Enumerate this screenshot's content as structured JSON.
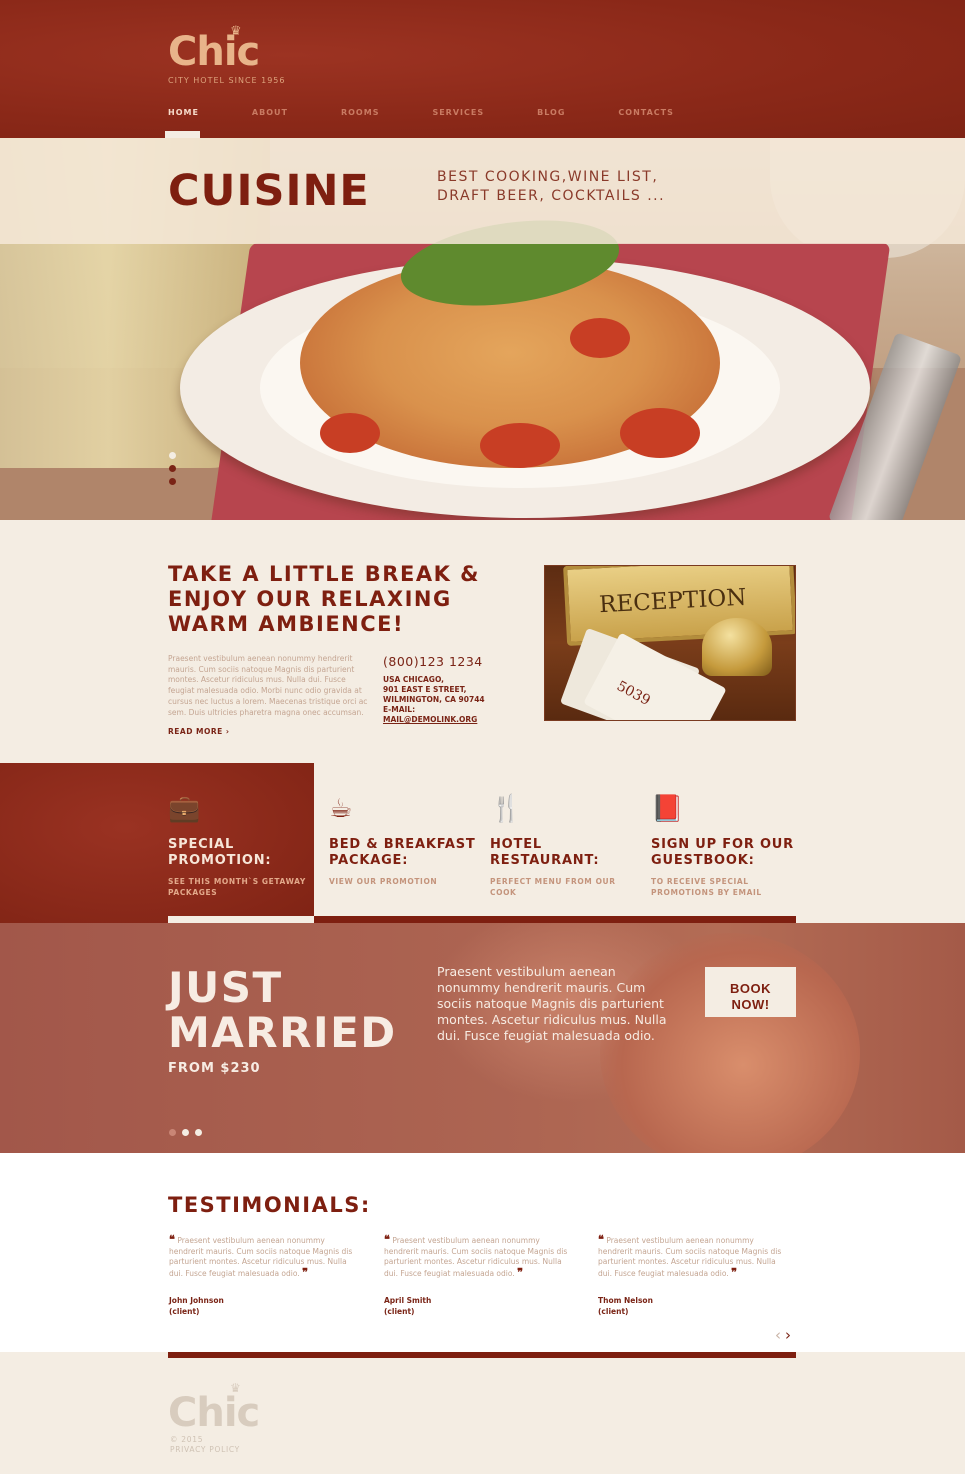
{
  "header": {
    "logo_text": "Chic",
    "tagline": "CITY HOTEL SINCE 1956",
    "nav": [
      {
        "label": "HOME",
        "active": true
      },
      {
        "label": "ABOUT",
        "active": false
      },
      {
        "label": "ROOMS",
        "active": false
      },
      {
        "label": "SERVICES",
        "active": false
      },
      {
        "label": "BLOG",
        "active": false
      },
      {
        "label": "CONTACTS",
        "active": false
      }
    ]
  },
  "hero": {
    "title": "CUISINE",
    "subtitle": "BEST COOKING,WINE LIST, DRAFT BEER, COCKTAILS ...",
    "slides_count": 3,
    "active_slide": 1
  },
  "about": {
    "title": "TAKE A LITTLE BREAK & ENJOY OUR RELAXING WARM AMBIENCE!",
    "text": "Praesent vestibulum aenean nonummy hendrerit mauris. Cum sociis natoque Magnis dis parturient montes. Ascetur ridiculus mus. Nulla dui. Fusce feugiat malesuada odio. Morbi nunc odio gravida at cursus nec luctus a lorem. Maecenas tristique orci ac sem. Duis ultricies pharetra magna onec accumsan.",
    "read_more": "READ MORE",
    "phone": "(800)123 1234",
    "address_line1": "USA  CHICAGO,",
    "address_line2": "901 EAST E STREET,",
    "address_line3": "WILMINGTON, CA 90744",
    "email_label": "E-MAIL:",
    "email": "MAIL@DEMOLINK.ORG",
    "image_sign_text": "RECEPTION",
    "image_card_text": "5039"
  },
  "features": [
    {
      "icon": "suitcase-icon",
      "glyph": "💼",
      "title": "SPECIAL PROMOTION:",
      "subtitle": "SEE THIS MONTH`S GETAWAY PACKAGES",
      "highlight": true
    },
    {
      "icon": "cup-icon",
      "glyph": "☕",
      "title": "BED & BREAKFAST PACKAGE:",
      "subtitle": "VIEW OUR PROMOTION",
      "highlight": false
    },
    {
      "icon": "fork-knife-icon",
      "glyph": "🍴",
      "title": "HOTEL RESTAURANT:",
      "subtitle": "PERFECT MENU FROM OUR COOK",
      "highlight": false
    },
    {
      "icon": "book-icon",
      "glyph": "📕",
      "title": "SIGN UP FOR OUR GUESTBOOK:",
      "subtitle": "TO RECEIVE SPECIAL PROMOTIONS BY EMAIL",
      "highlight": false
    }
  ],
  "promo": {
    "title_line1": "JUST",
    "title_line2": "MARRIED",
    "price": "FROM $230",
    "text": "Praesent vestibulum aenean nonummy hendrerit mauris. Cum sociis natoque Magnis dis parturient montes. Ascetur ridiculus mus. Nulla dui. Fusce feugiat malesuada odio.",
    "button_line1": "BOOK",
    "button_line2": "NOW!"
  },
  "testimonials": {
    "title": "TESTIMONIALS:",
    "items": [
      {
        "text": "Praesent vestibulum aenean nonummy hendrerit mauris. Cum sociis natoque Magnis dis parturient montes. Ascetur ridiculus mus. Nulla dui. Fusce feugiat malesuada odio.",
        "name": "John Johnson",
        "role": "(client)"
      },
      {
        "text": "Praesent vestibulum aenean nonummy hendrerit mauris. Cum sociis natoque Magnis dis parturient montes. Ascetur ridiculus mus. Nulla dui. Fusce feugiat malesuada odio.",
        "name": "April Smith",
        "role": "(client)"
      },
      {
        "text": "Praesent vestibulum aenean nonummy hendrerit mauris. Cum sociis natoque Magnis dis parturient montes. Ascetur ridiculus mus. Nulla dui. Fusce feugiat malesuada odio.",
        "name": "Thom Nelson",
        "role": "(client)"
      }
    ],
    "open_quote": "❝",
    "close_quote": "❞"
  },
  "footer": {
    "logo_text": "Chic",
    "copyright": "© 2015",
    "privacy": "PRIVACY POLICY"
  },
  "colors": {
    "brand": "#8e2a1c",
    "dark_red": "#7e1f10",
    "cream": "#f4ede3"
  }
}
